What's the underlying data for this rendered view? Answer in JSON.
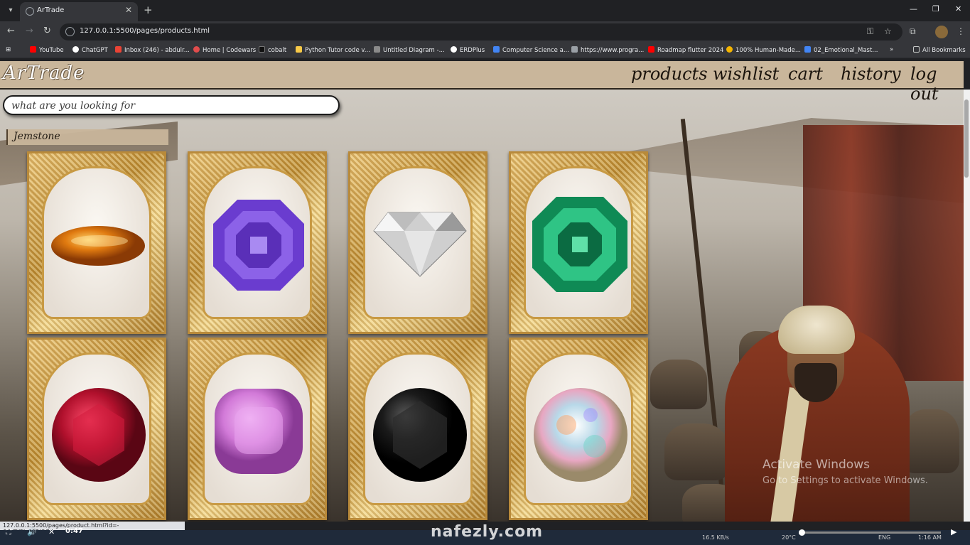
{
  "browser": {
    "tab_title": "ArTrade",
    "url": "127.0.0.1:5500/pages/products.html",
    "bookmarks": [
      "YouTube",
      "ChatGPT",
      "Inbox (246) - abdulr...",
      "Home | Codewars",
      "cobalt",
      "Python Tutor code v...",
      "Untitled Diagram -...",
      "ERDPlus",
      "Computer Science a...",
      "https://www.progra...",
      "Roadmap flutter 2024",
      "100% Human-Made...",
      "02_Emotional_Mast..."
    ],
    "all_bookmarks": "All Bookmarks",
    "colors": [
      "#ff0000",
      "#ffffff",
      "#ea4335",
      "#e04c4c",
      "#111111",
      "#f7c948",
      "#8a8a8a",
      "#ffffff",
      "#4285f4",
      "#9aa0a6",
      "#ff0000",
      "#f4b400",
      "#4285f4"
    ]
  },
  "site": {
    "logo": "ArTrade",
    "nav": [
      "products",
      "wishlist",
      "cart",
      "history",
      "log out"
    ],
    "search_placeholder": "what are you looking for",
    "category": "Jemstone"
  },
  "products": [
    {
      "gem": "amber",
      "color": "#e07a10"
    },
    {
      "gem": "amethyst",
      "color": "#7b4fd6"
    },
    {
      "gem": "diamond",
      "color": "#d8d8d8"
    },
    {
      "gem": "emerald",
      "color": "#1aa36a"
    },
    {
      "gem": "ruby",
      "color": "#b0102c"
    },
    {
      "gem": "pink-sapphire",
      "color": "#d27ad8"
    },
    {
      "gem": "black-onyx",
      "color": "#1a1a1a"
    },
    {
      "gem": "opal",
      "color": "#b8d8e8"
    }
  ],
  "overlay": {
    "activate_title": "Activate Windows",
    "activate_sub": "Go to Settings to activate Windows.",
    "status_url": "127.0.0.1:5500/pages/product.html?id=-OjkGY2Ix5E9lQCXvgwK",
    "watermark": "nafezly.com",
    "player_time": "0:47",
    "player_progress": 0.02,
    "tray_speed": "16.5 KB/s",
    "tray_lang": "ENG",
    "tray_time": "1:16 AM",
    "tray_temp": "20°C"
  }
}
